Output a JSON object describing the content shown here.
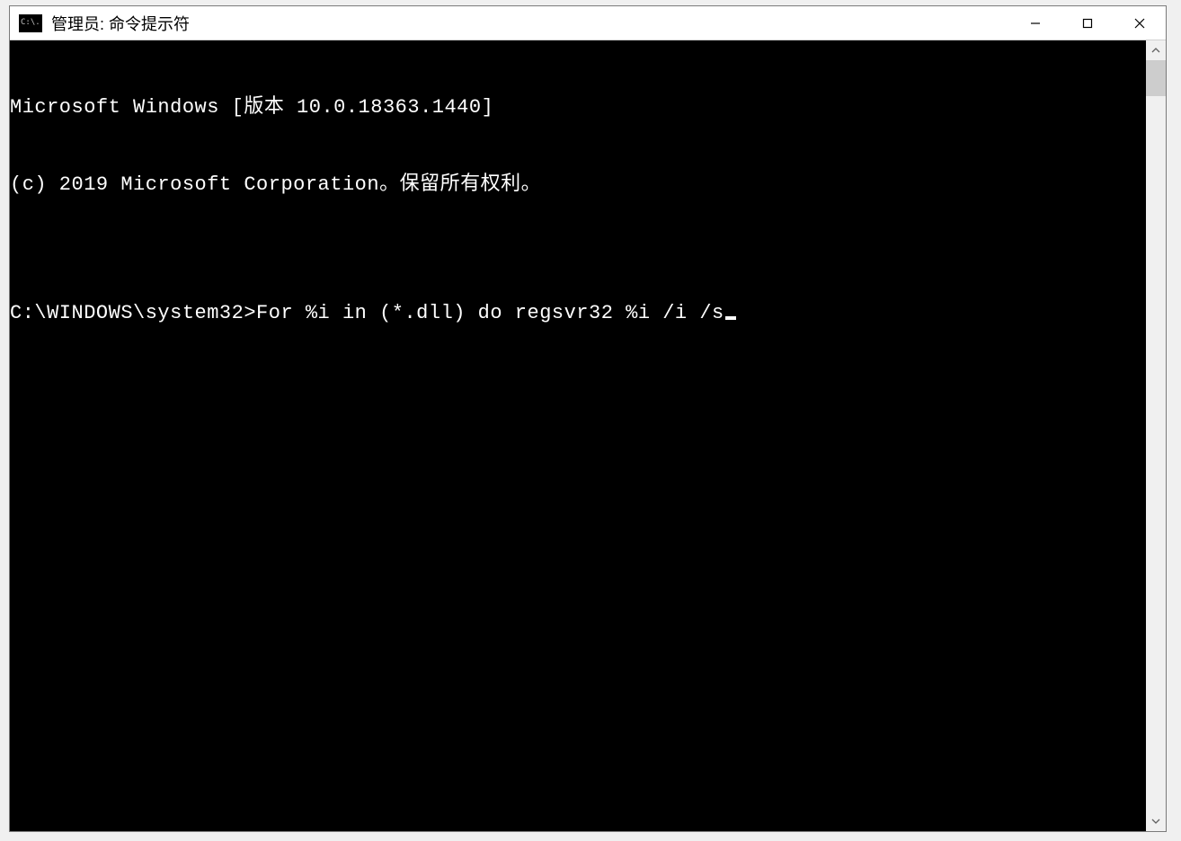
{
  "window": {
    "title": "管理员: 命令提示符",
    "icon_text": "C:\\."
  },
  "terminal": {
    "line1": "Microsoft Windows [版本 10.0.18363.1440]",
    "line2": "(c) 2019 Microsoft Corporation。保留所有权利。",
    "blank": "",
    "prompt": "C:\\WINDOWS\\system32>",
    "command": "For %i in (*.dll) do regsvr32 %i /i /s"
  }
}
